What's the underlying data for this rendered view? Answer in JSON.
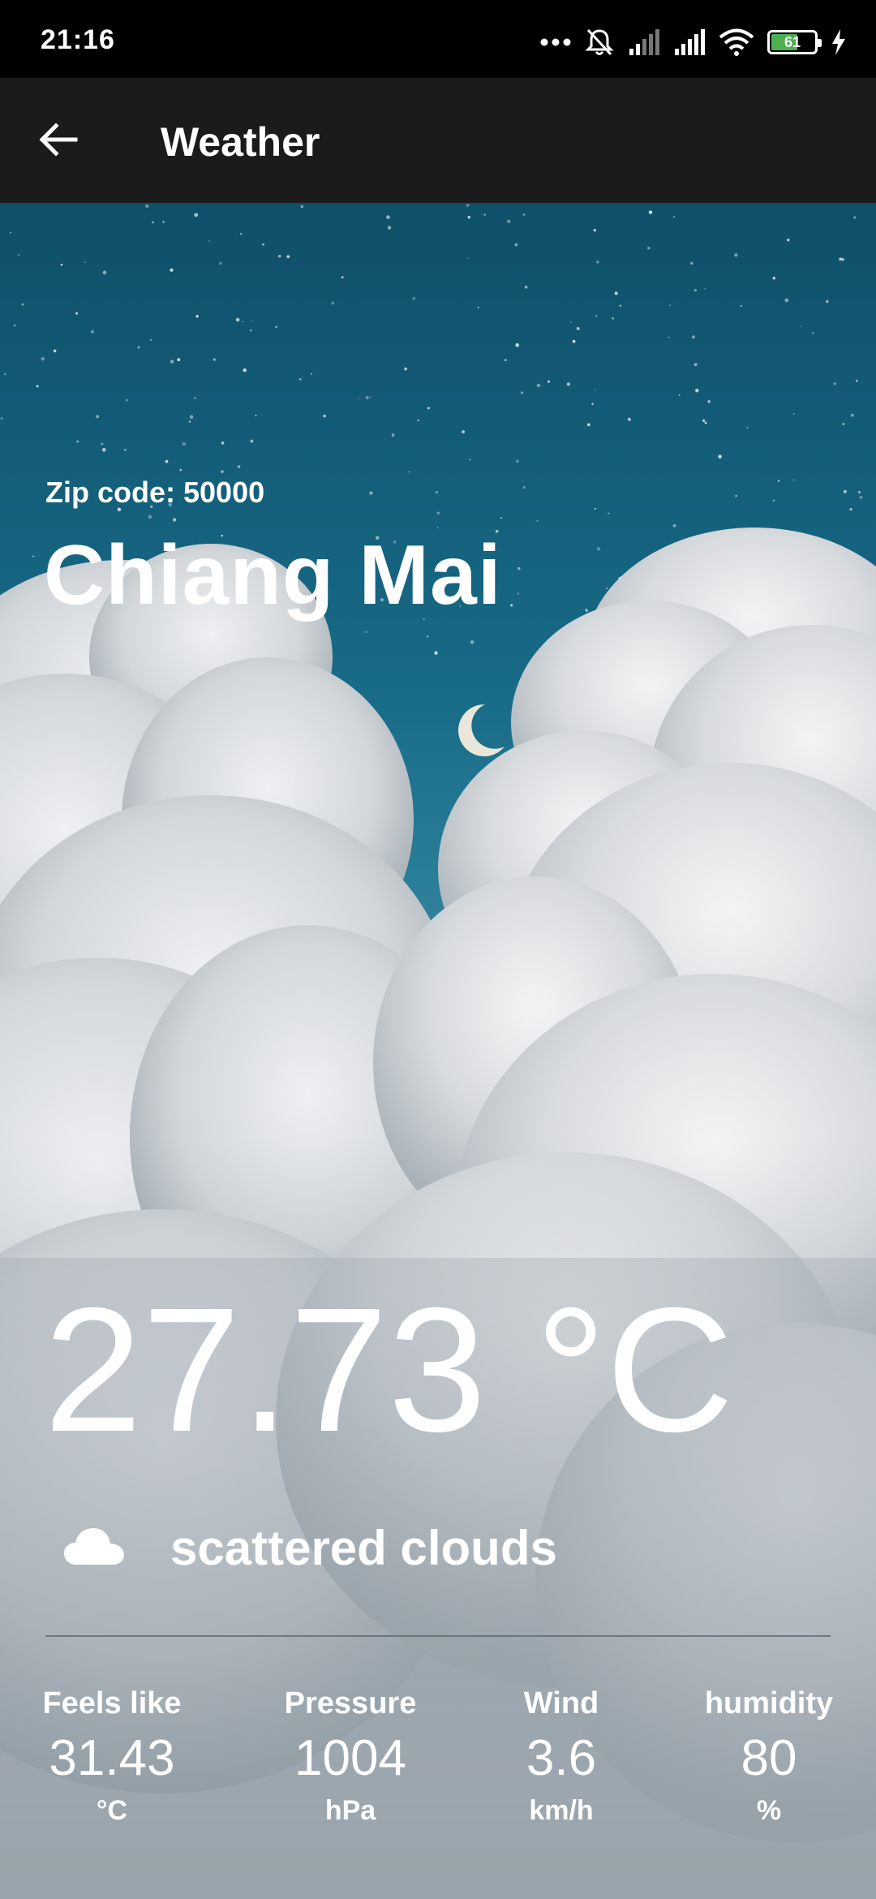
{
  "status_bar": {
    "time": "21:16",
    "battery_level": "61",
    "battery_fraction": 0.61,
    "icons": [
      "more-dots-icon",
      "mute-bell-icon",
      "cell-signal-1-icon",
      "cell-signal-2-icon",
      "wifi-icon",
      "battery-icon",
      "charging-bolt-icon"
    ]
  },
  "app_bar": {
    "title": "Weather",
    "back_icon": "arrow-left-icon",
    "color": "#1b1b1b"
  },
  "location": {
    "zip_code_label": "Zip code: 50000",
    "city": "Chiang Mai"
  },
  "current": {
    "temperature": "27.73 °C",
    "condition_icon": "cloud-icon",
    "condition": "scattered clouds"
  },
  "stats": [
    {
      "label": "Feels like",
      "value": "31.43",
      "unit": "°C"
    },
    {
      "label": "Pressure",
      "value": "1004",
      "unit": "hPa"
    },
    {
      "label": "Wind",
      "value": "3.6",
      "unit": "km/h"
    },
    {
      "label": "humidity",
      "value": "80",
      "unit": "%"
    }
  ],
  "colors": {
    "sky_top": "#0f4f69",
    "sky_mid": "#176a86",
    "cloud": "#d9dcdf",
    "battery_fill": "#4caf50"
  }
}
